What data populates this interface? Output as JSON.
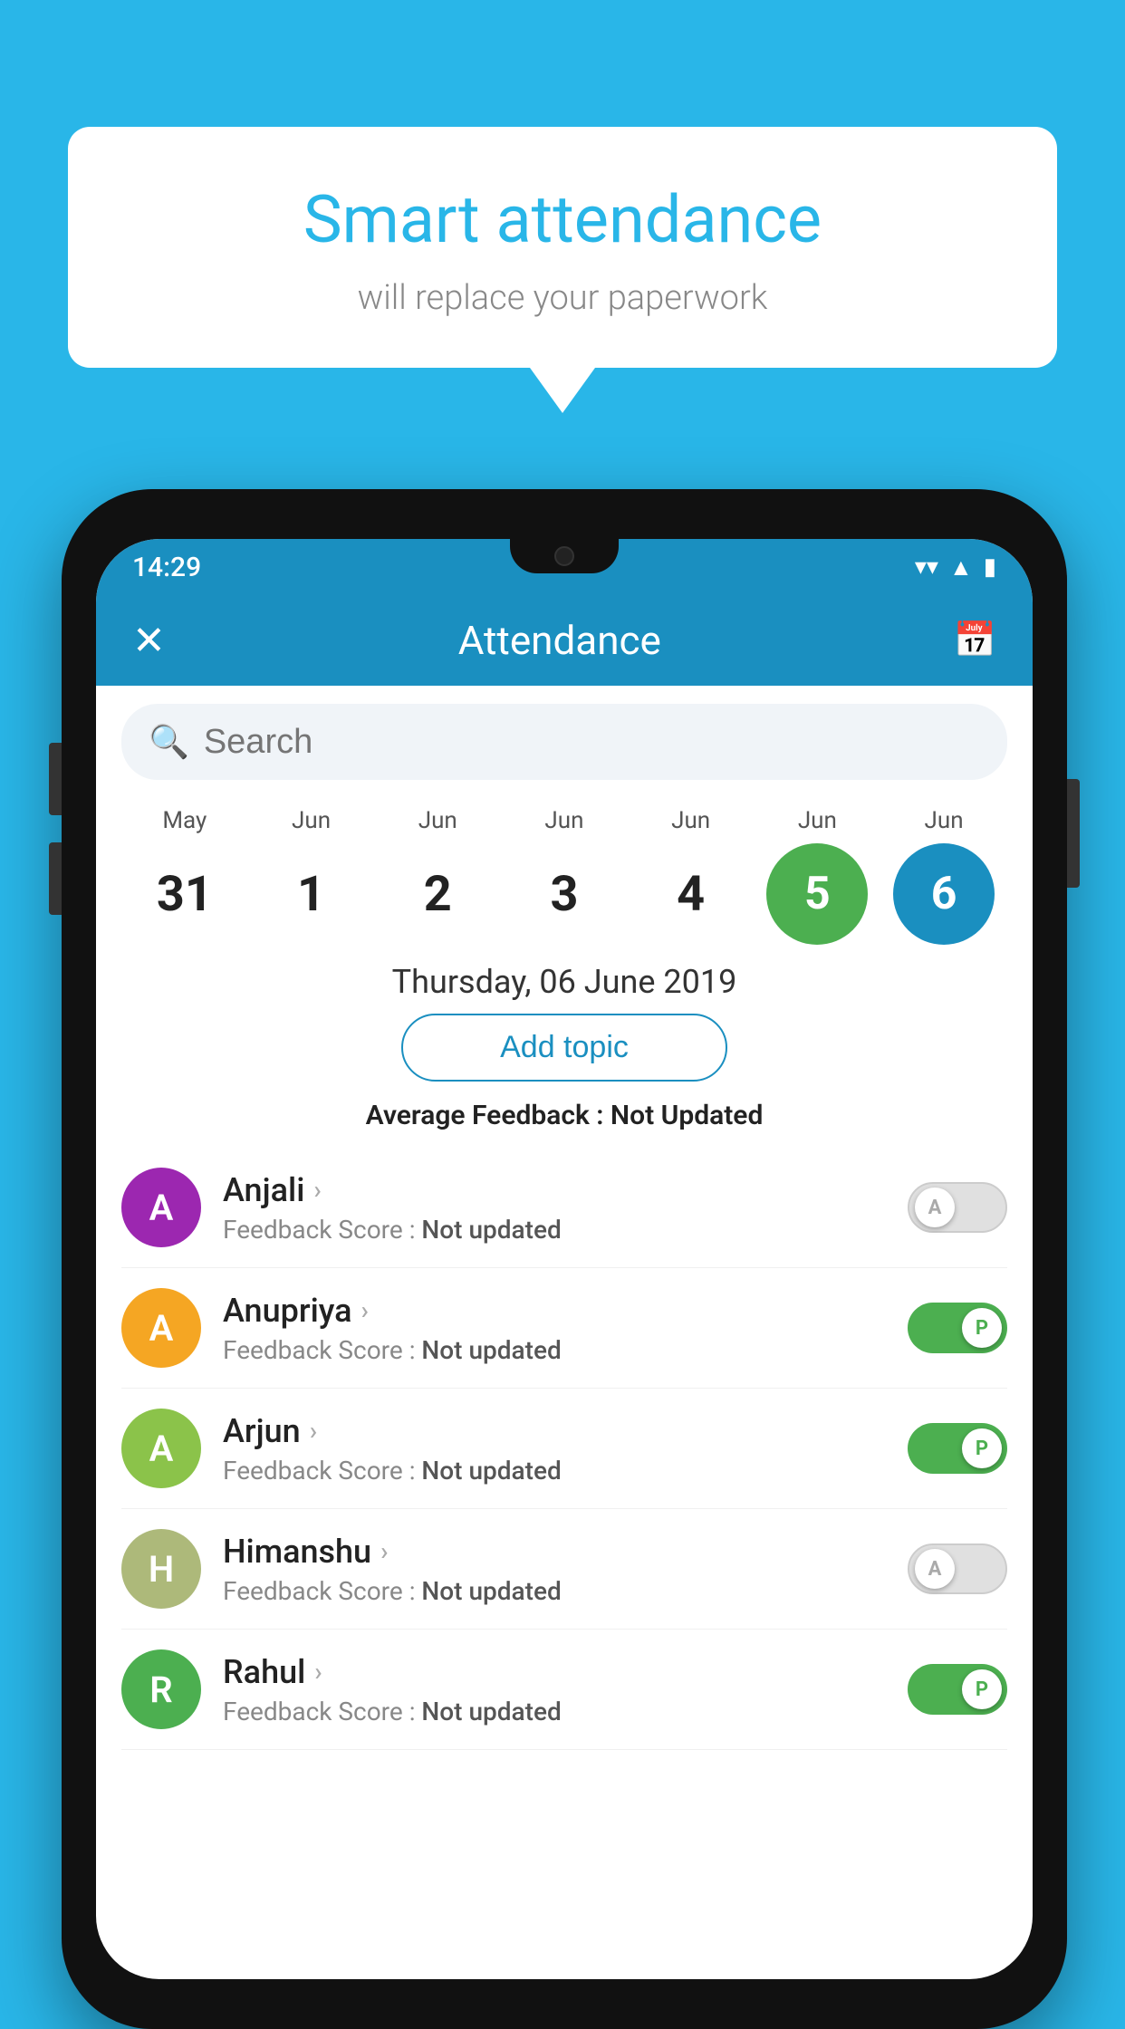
{
  "background_color": "#29b6e8",
  "speech_bubble": {
    "title": "Smart attendance",
    "subtitle": "will replace your paperwork"
  },
  "status_bar": {
    "time": "14:29",
    "icons": [
      "wifi",
      "signal",
      "battery"
    ]
  },
  "header": {
    "title": "Attendance",
    "close_label": "✕",
    "calendar_label": "📅"
  },
  "search": {
    "placeholder": "Search"
  },
  "calendar": {
    "days": [
      {
        "month": "May",
        "date": "31",
        "state": "normal"
      },
      {
        "month": "Jun",
        "date": "1",
        "state": "normal"
      },
      {
        "month": "Jun",
        "date": "2",
        "state": "normal"
      },
      {
        "month": "Jun",
        "date": "3",
        "state": "normal"
      },
      {
        "month": "Jun",
        "date": "4",
        "state": "normal"
      },
      {
        "month": "Jun",
        "date": "5",
        "state": "today"
      },
      {
        "month": "Jun",
        "date": "6",
        "state": "selected"
      }
    ]
  },
  "selected_date": "Thursday, 06 June 2019",
  "add_topic_label": "Add topic",
  "avg_feedback_label": "Average Feedback :",
  "avg_feedback_value": "Not Updated",
  "students": [
    {
      "name": "Anjali",
      "avatar_letter": "A",
      "avatar_color": "#9c27b0",
      "feedback_label": "Feedback Score :",
      "feedback_value": "Not updated",
      "toggle": "off",
      "toggle_letter": "A"
    },
    {
      "name": "Anupriya",
      "avatar_letter": "A",
      "avatar_color": "#f5a623",
      "feedback_label": "Feedback Score :",
      "feedback_value": "Not updated",
      "toggle": "on",
      "toggle_letter": "P"
    },
    {
      "name": "Arjun",
      "avatar_letter": "A",
      "avatar_color": "#8bc34a",
      "feedback_label": "Feedback Score :",
      "feedback_value": "Not updated",
      "toggle": "on",
      "toggle_letter": "P"
    },
    {
      "name": "Himanshu",
      "avatar_letter": "H",
      "avatar_color": "#adb97a",
      "feedback_label": "Feedback Score :",
      "feedback_value": "Not updated",
      "toggle": "off",
      "toggle_letter": "A"
    },
    {
      "name": "Rahul",
      "avatar_letter": "R",
      "avatar_color": "#4caf50",
      "feedback_label": "Feedback Score :",
      "feedback_value": "Not updated",
      "toggle": "on",
      "toggle_letter": "P"
    }
  ]
}
